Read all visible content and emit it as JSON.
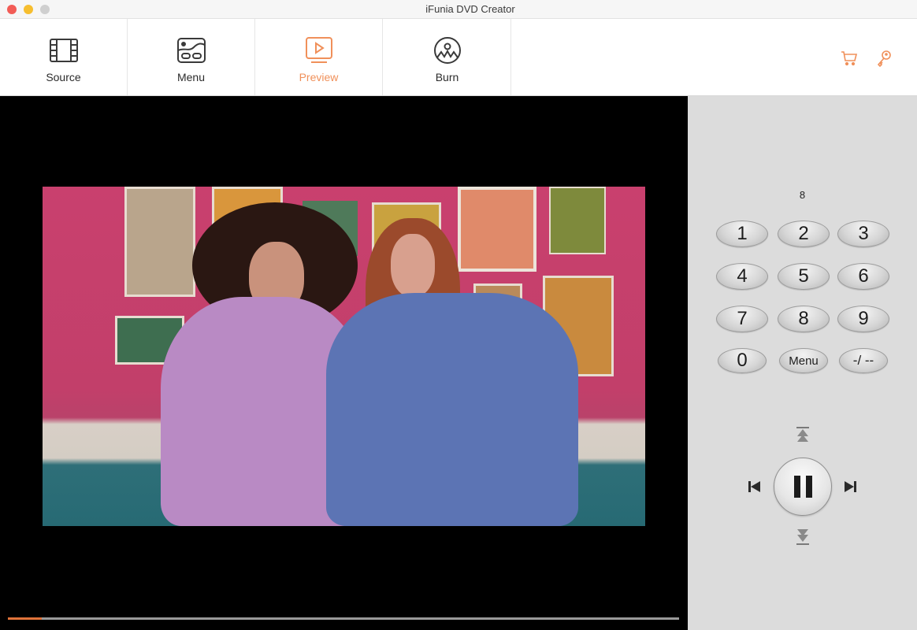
{
  "window": {
    "title": "iFunia DVD Creator"
  },
  "toolbar": {
    "tabs": [
      {
        "id": "source",
        "label": "Source",
        "icon": "film-strip-icon",
        "active": false
      },
      {
        "id": "menu",
        "label": "Menu",
        "icon": "menu-layout-icon",
        "active": false
      },
      {
        "id": "preview",
        "label": "Preview",
        "icon": "play-screen-icon",
        "active": true
      },
      {
        "id": "burn",
        "label": "Burn",
        "icon": "disc-burn-icon",
        "active": false
      }
    ],
    "actions": [
      {
        "id": "cart",
        "icon": "cart-icon"
      },
      {
        "id": "register",
        "icon": "key-icon"
      }
    ],
    "accent_color": "#f0905a"
  },
  "player": {
    "playback_progress_percent": 5,
    "progress_color": "#e0733a",
    "state": "playing"
  },
  "remote": {
    "display_value": "8",
    "keys": [
      {
        "label": "1"
      },
      {
        "label": "2"
      },
      {
        "label": "3"
      },
      {
        "label": "4"
      },
      {
        "label": "5"
      },
      {
        "label": "6"
      },
      {
        "label": "7"
      },
      {
        "label": "8"
      },
      {
        "label": "9"
      },
      {
        "label": "0"
      },
      {
        "label": "Menu"
      },
      {
        "label": "-/ --"
      }
    ],
    "nav": {
      "up": "skip-to-top-icon",
      "down": "skip-to-bottom-icon",
      "previous": "previous-chapter-icon",
      "next": "next-chapter-icon",
      "center": "pause-icon"
    }
  }
}
